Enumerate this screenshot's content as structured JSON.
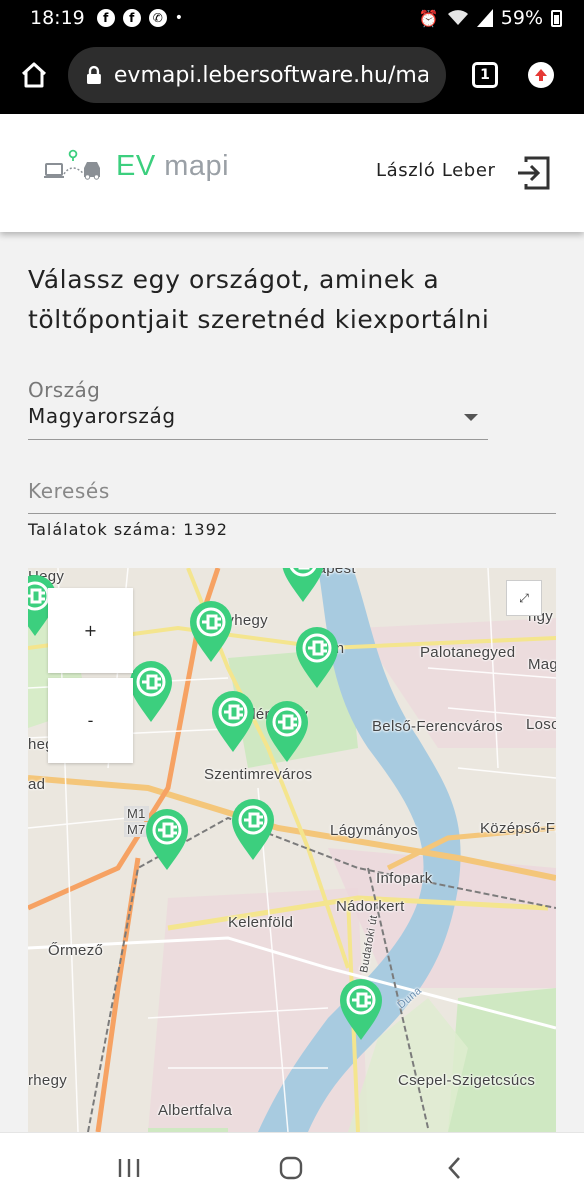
{
  "status_bar": {
    "time": "18:19",
    "battery": "59%",
    "icons": [
      "facebook-icon",
      "facebook-icon",
      "viber-icon",
      "dot-icon",
      "alarm-icon",
      "wifi-icon",
      "signal-icon",
      "battery-icon"
    ]
  },
  "browser": {
    "url": "evmapi.lebersoftware.hu/ma",
    "tab_count": "1"
  },
  "header": {
    "logo_ev": "EV",
    "logo_mapi": "mapi",
    "user_name": "László Leber",
    "brand_color": "#3ccf7e"
  },
  "main": {
    "heading": "Válassz egy országot, aminek a töltőpontjait szeretnéd kiexportálni",
    "country_label": "Ország",
    "country_value": "Magyarország",
    "search_placeholder": "Keresés",
    "results_text": "Találatok száma: 1392"
  },
  "map": {
    "zoom_in": "+",
    "zoom_out": "-",
    "fullscreen": "⤢",
    "marker_color": "#3ccf7e",
    "labels": [
      "Budapest",
      "Nagyhegy",
      "Tabán",
      "Palotanegyed",
      "Mag",
      "Hegy",
      "Gellérthegy",
      "Belső-Ferencváros",
      "Loso",
      "Szentimreváros",
      "ad",
      "M1",
      "M7",
      "Lágymányos",
      "Középső-Fe",
      "Infopark",
      "Nádorkert",
      "Kelenföld",
      "Budafoki út",
      "Őrmező",
      "Duna",
      "Csepel-Szigetcsúcs",
      "rhegy",
      "Albertfalva",
      "hegy",
      "ngy"
    ]
  }
}
